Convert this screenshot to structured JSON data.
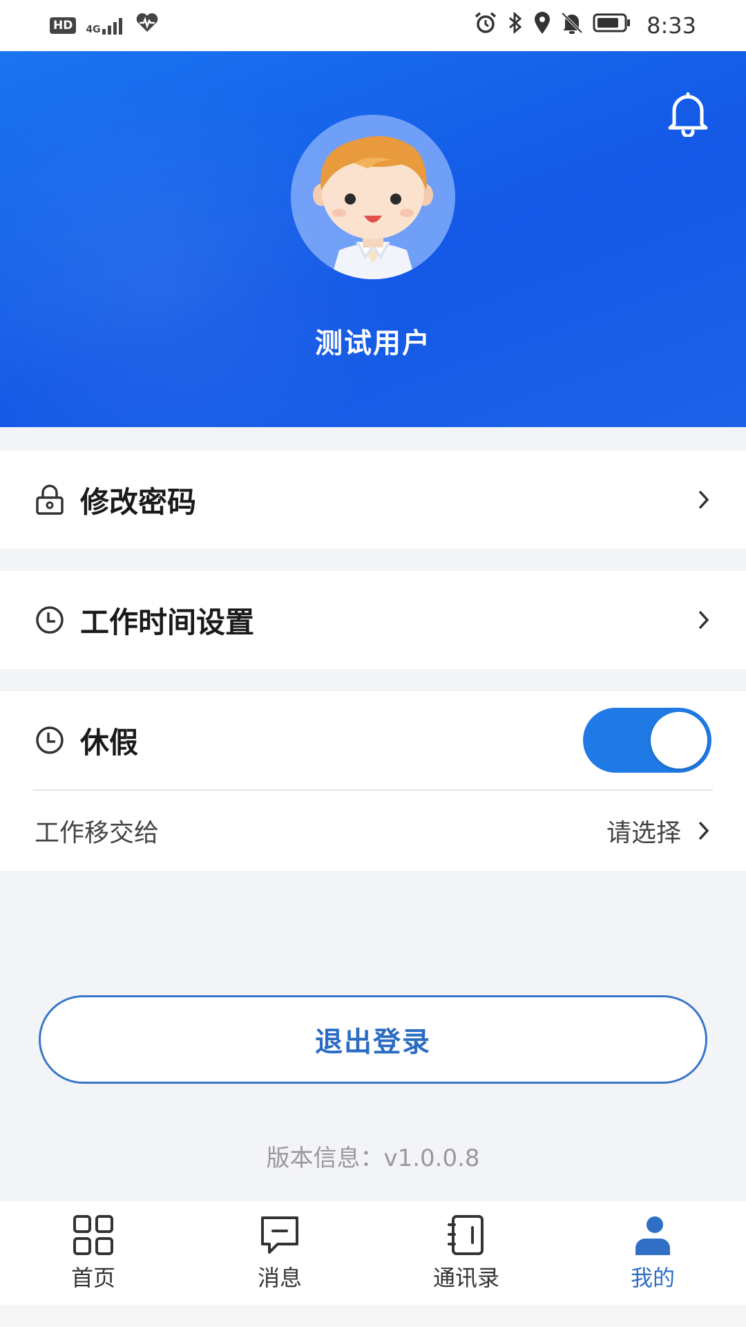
{
  "status_bar": {
    "hd_badge": "HD",
    "network": "4G",
    "time": "8:33",
    "icons": [
      "signal-icon",
      "heart-pulse-icon",
      "alarm-icon",
      "bluetooth-icon",
      "location-icon",
      "mute-bell-icon",
      "battery-icon"
    ]
  },
  "header": {
    "user_name": "测试用户",
    "bell_icon": "bell-icon",
    "background_color": "#1565e8"
  },
  "menu": {
    "change_password": {
      "label": "修改密码",
      "icon": "lock-icon"
    },
    "work_time": {
      "label": "工作时间设置",
      "icon": "clock-icon"
    },
    "vacation": {
      "label": "休假",
      "icon": "clock-icon",
      "toggle_on": true
    },
    "transfer": {
      "label": "工作移交给",
      "value": "请选择"
    }
  },
  "logout": {
    "label": "退出登录"
  },
  "version": {
    "text": "版本信息：v1.0.0.8"
  },
  "bottom_nav": {
    "items": [
      {
        "label": "首页",
        "icon": "grid-icon",
        "active": false
      },
      {
        "label": "消息",
        "icon": "message-icon",
        "active": false
      },
      {
        "label": "通讯录",
        "icon": "contacts-book-icon",
        "active": false
      },
      {
        "label": "我的",
        "icon": "user-icon",
        "active": true
      }
    ]
  },
  "colors": {
    "accent": "#1f7ae6",
    "logout_text": "#2b6cc3",
    "active_tab": "#2f6fc6"
  }
}
